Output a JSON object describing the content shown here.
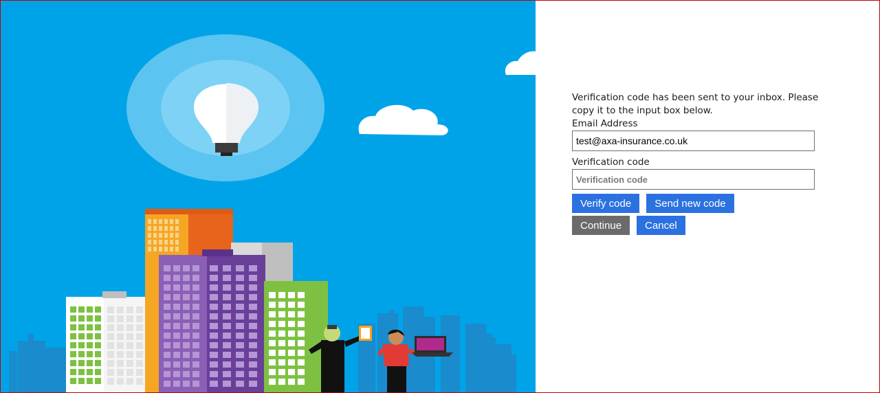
{
  "form": {
    "intro": "Verification code has been sent to your inbox. Please copy it to the input box below.",
    "email_label": "Email Address",
    "email_value": "test@axa-insurance.co.uk",
    "code_label": "Verification code",
    "code_placeholder": "Verification code",
    "verify_button": "Verify code",
    "send_new_button": "Send new code",
    "continue_button": "Continue",
    "cancel_button": "Cancel"
  },
  "colors": {
    "sky": "#00a3e8",
    "primary_button": "#2b71e0",
    "continue_button": "#6b6b6b",
    "frame_border": "#c00000"
  }
}
